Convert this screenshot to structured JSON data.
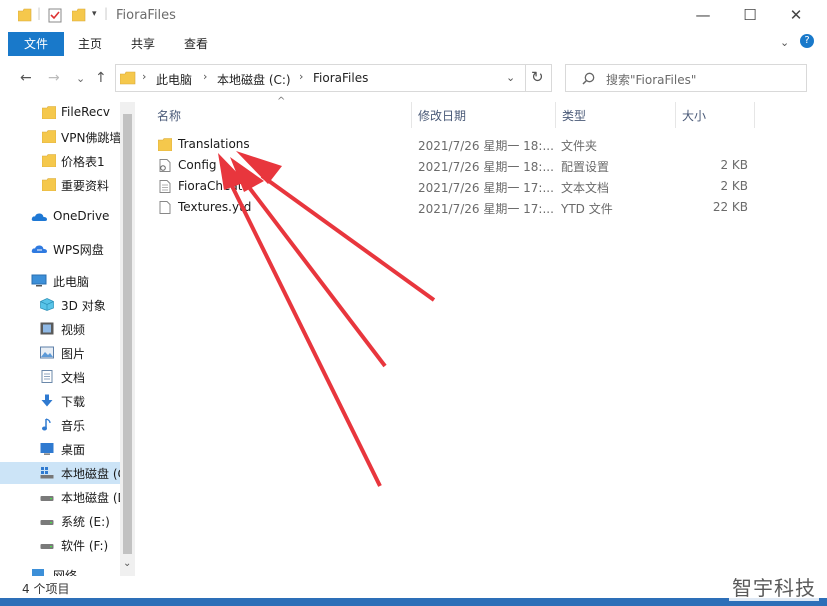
{
  "window": {
    "title": "FioraFiles",
    "controls": {
      "minimize": "—",
      "maximize": "☐",
      "close": "✕"
    }
  },
  "ribbon": {
    "tabs": [
      "文件",
      "主页",
      "共享",
      "查看"
    ],
    "expand": "⌄",
    "help": "?"
  },
  "nav": {
    "back": "←",
    "forward": "→",
    "recent": "⌄",
    "up": "↑",
    "breadcrumb": [
      "此电脑",
      "本地磁盘 (C:)",
      "FioraFiles"
    ],
    "separator": "›",
    "dropdown": "⌄",
    "refresh": "↻",
    "search_placeholder": "搜索\"FioraFiles\""
  },
  "sidebar": {
    "items": [
      {
        "label": "FileRecv",
        "icon": "folder-icon"
      },
      {
        "label": "VPN佛跳墙",
        "icon": "folder-icon"
      },
      {
        "label": "价格表1",
        "icon": "folder-icon"
      },
      {
        "label": "重要资料",
        "icon": "folder-icon"
      },
      {
        "label": "OneDrive",
        "icon": "onedrive-icon"
      },
      {
        "label": "WPS网盘",
        "icon": "wps-cloud-icon"
      },
      {
        "label": "此电脑",
        "icon": "computer-icon"
      },
      {
        "label": "3D 对象",
        "icon": "3d-objects-icon"
      },
      {
        "label": "视频",
        "icon": "video-icon"
      },
      {
        "label": "图片",
        "icon": "pictures-icon"
      },
      {
        "label": "文档",
        "icon": "documents-icon"
      },
      {
        "label": "下载",
        "icon": "download-icon"
      },
      {
        "label": "音乐",
        "icon": "music-icon"
      },
      {
        "label": "桌面",
        "icon": "desktop-icon"
      },
      {
        "label": "本地磁盘 (C:)",
        "icon": "drive-c-icon",
        "selected": true
      },
      {
        "label": "本地磁盘 (D:)",
        "icon": "drive-icon"
      },
      {
        "label": "系统 (E:)",
        "icon": "drive-icon"
      },
      {
        "label": "软件 (F:)",
        "icon": "drive-icon"
      },
      {
        "label": "网络",
        "icon": "network-icon"
      }
    ],
    "scroll_down": "⌄"
  },
  "columns": {
    "name": "名称",
    "date": "修改日期",
    "type": "类型",
    "size": "大小",
    "sort_indicator": "^"
  },
  "files": [
    {
      "name": "Translations",
      "date": "2021/7/26 星期一 18:...",
      "type": "文件夹",
      "size": "",
      "icon": "folder-icon"
    },
    {
      "name": "Config",
      "date": "2021/7/26 星期一 18:...",
      "type": "配置设置",
      "size": "2 KB",
      "icon": "config-file-icon"
    },
    {
      "name": "FioraCheat",
      "date": "2021/7/26 星期一 17:...",
      "type": "文本文档",
      "size": "2 KB",
      "icon": "text-file-icon"
    },
    {
      "name": "Textures.ytd",
      "date": "2021/7/26 星期一 17:...",
      "type": "YTD 文件",
      "size": "22 KB",
      "icon": "file-icon"
    }
  ],
  "status": {
    "count": "4 个项目"
  },
  "watermark": "智宇科技",
  "colors": {
    "accent": "#1979ca",
    "arrow": "#e8363d",
    "selected": "#cce4f7",
    "folder": "#f5c84c"
  }
}
